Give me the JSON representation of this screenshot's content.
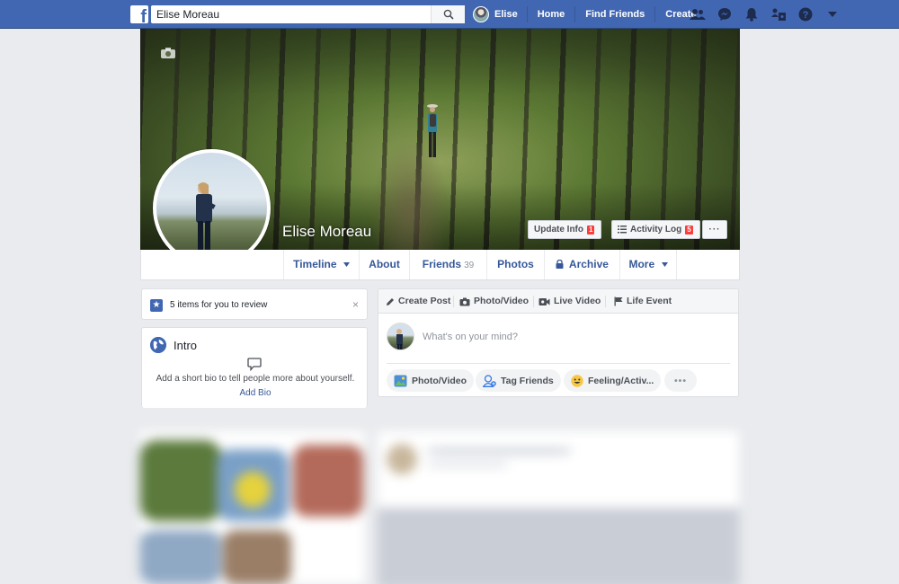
{
  "topbar": {
    "logo": "f",
    "search_value": "Elise Moreau",
    "search_placeholder": "Search",
    "user_name": "Elise",
    "links": [
      "Home",
      "Find Friends",
      "Create"
    ],
    "icons": [
      "friend-requests-icon",
      "messenger-icon",
      "notifications-icon",
      "groups-icon",
      "help-icon",
      "dropdown-caret-icon"
    ]
  },
  "profile": {
    "name": "Elise Moreau",
    "update_info_label": "Update Info",
    "update_info_badge": "1",
    "activity_log_label": "Activity Log",
    "activity_log_badge": "5",
    "more_dots": "···"
  },
  "tabs": {
    "timeline": "Timeline",
    "about": "About",
    "friends": "Friends",
    "friends_count": "39",
    "photos": "Photos",
    "archive": "Archive",
    "more": "More"
  },
  "review": {
    "text": "5 items for you to review",
    "close": "×"
  },
  "intro": {
    "title": "Intro",
    "bio_prompt": "Add a short bio to tell people more about yourself.",
    "add_bio": "Add Bio"
  },
  "composer": {
    "tabs": [
      "Create Post",
      "Photo/Video",
      "Live Video",
      "Life Event"
    ],
    "placeholder": "What's on your mind?",
    "actions": [
      "Photo/Video",
      "Tag Friends",
      "Feeling/Activ...",
      "•••"
    ]
  },
  "colors": {
    "brand": "#4267b2",
    "link": "#365899",
    "badge": "#fa3e3e",
    "page_bg": "#e9ebee"
  }
}
